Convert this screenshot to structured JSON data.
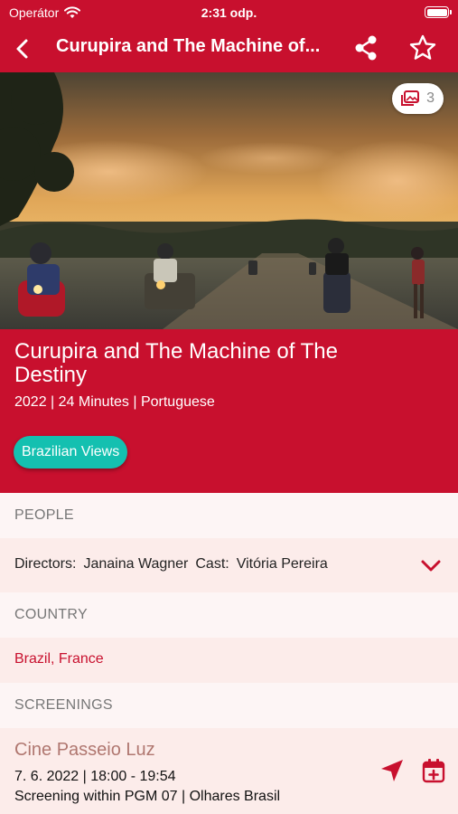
{
  "status_bar": {
    "carrier": "Operátor",
    "time": "2:31 odp."
  },
  "nav": {
    "title": "Curupira and The Machine of The Destiny",
    "title_display": "Curupira and The Machine of..."
  },
  "hero": {
    "gallery_count": "3"
  },
  "film": {
    "title": "Curupira and The Machine of The Destiny",
    "meta": "2022 | 24 Minutes | Portuguese",
    "section_chip": "Brazilian Views"
  },
  "people": {
    "header": "PEOPLE",
    "directors_label": "Directors:",
    "directors": "Janaina Wagner",
    "cast_label": "Cast:",
    "cast": "Vitória Pereira"
  },
  "country": {
    "header": "COUNTRY",
    "value": "Brazil, France"
  },
  "screenings": {
    "header": "SCREENINGS",
    "items": [
      {
        "venue": "Cine Passeio Luz",
        "when": "7. 6. 2022 | 18:00 - 19:54",
        "program": "Screening within PGM 07 | Olhares Brasil"
      }
    ]
  },
  "colors": {
    "brand": "#c8102e",
    "chip": "#14c0b0",
    "venue": "#b07770"
  }
}
